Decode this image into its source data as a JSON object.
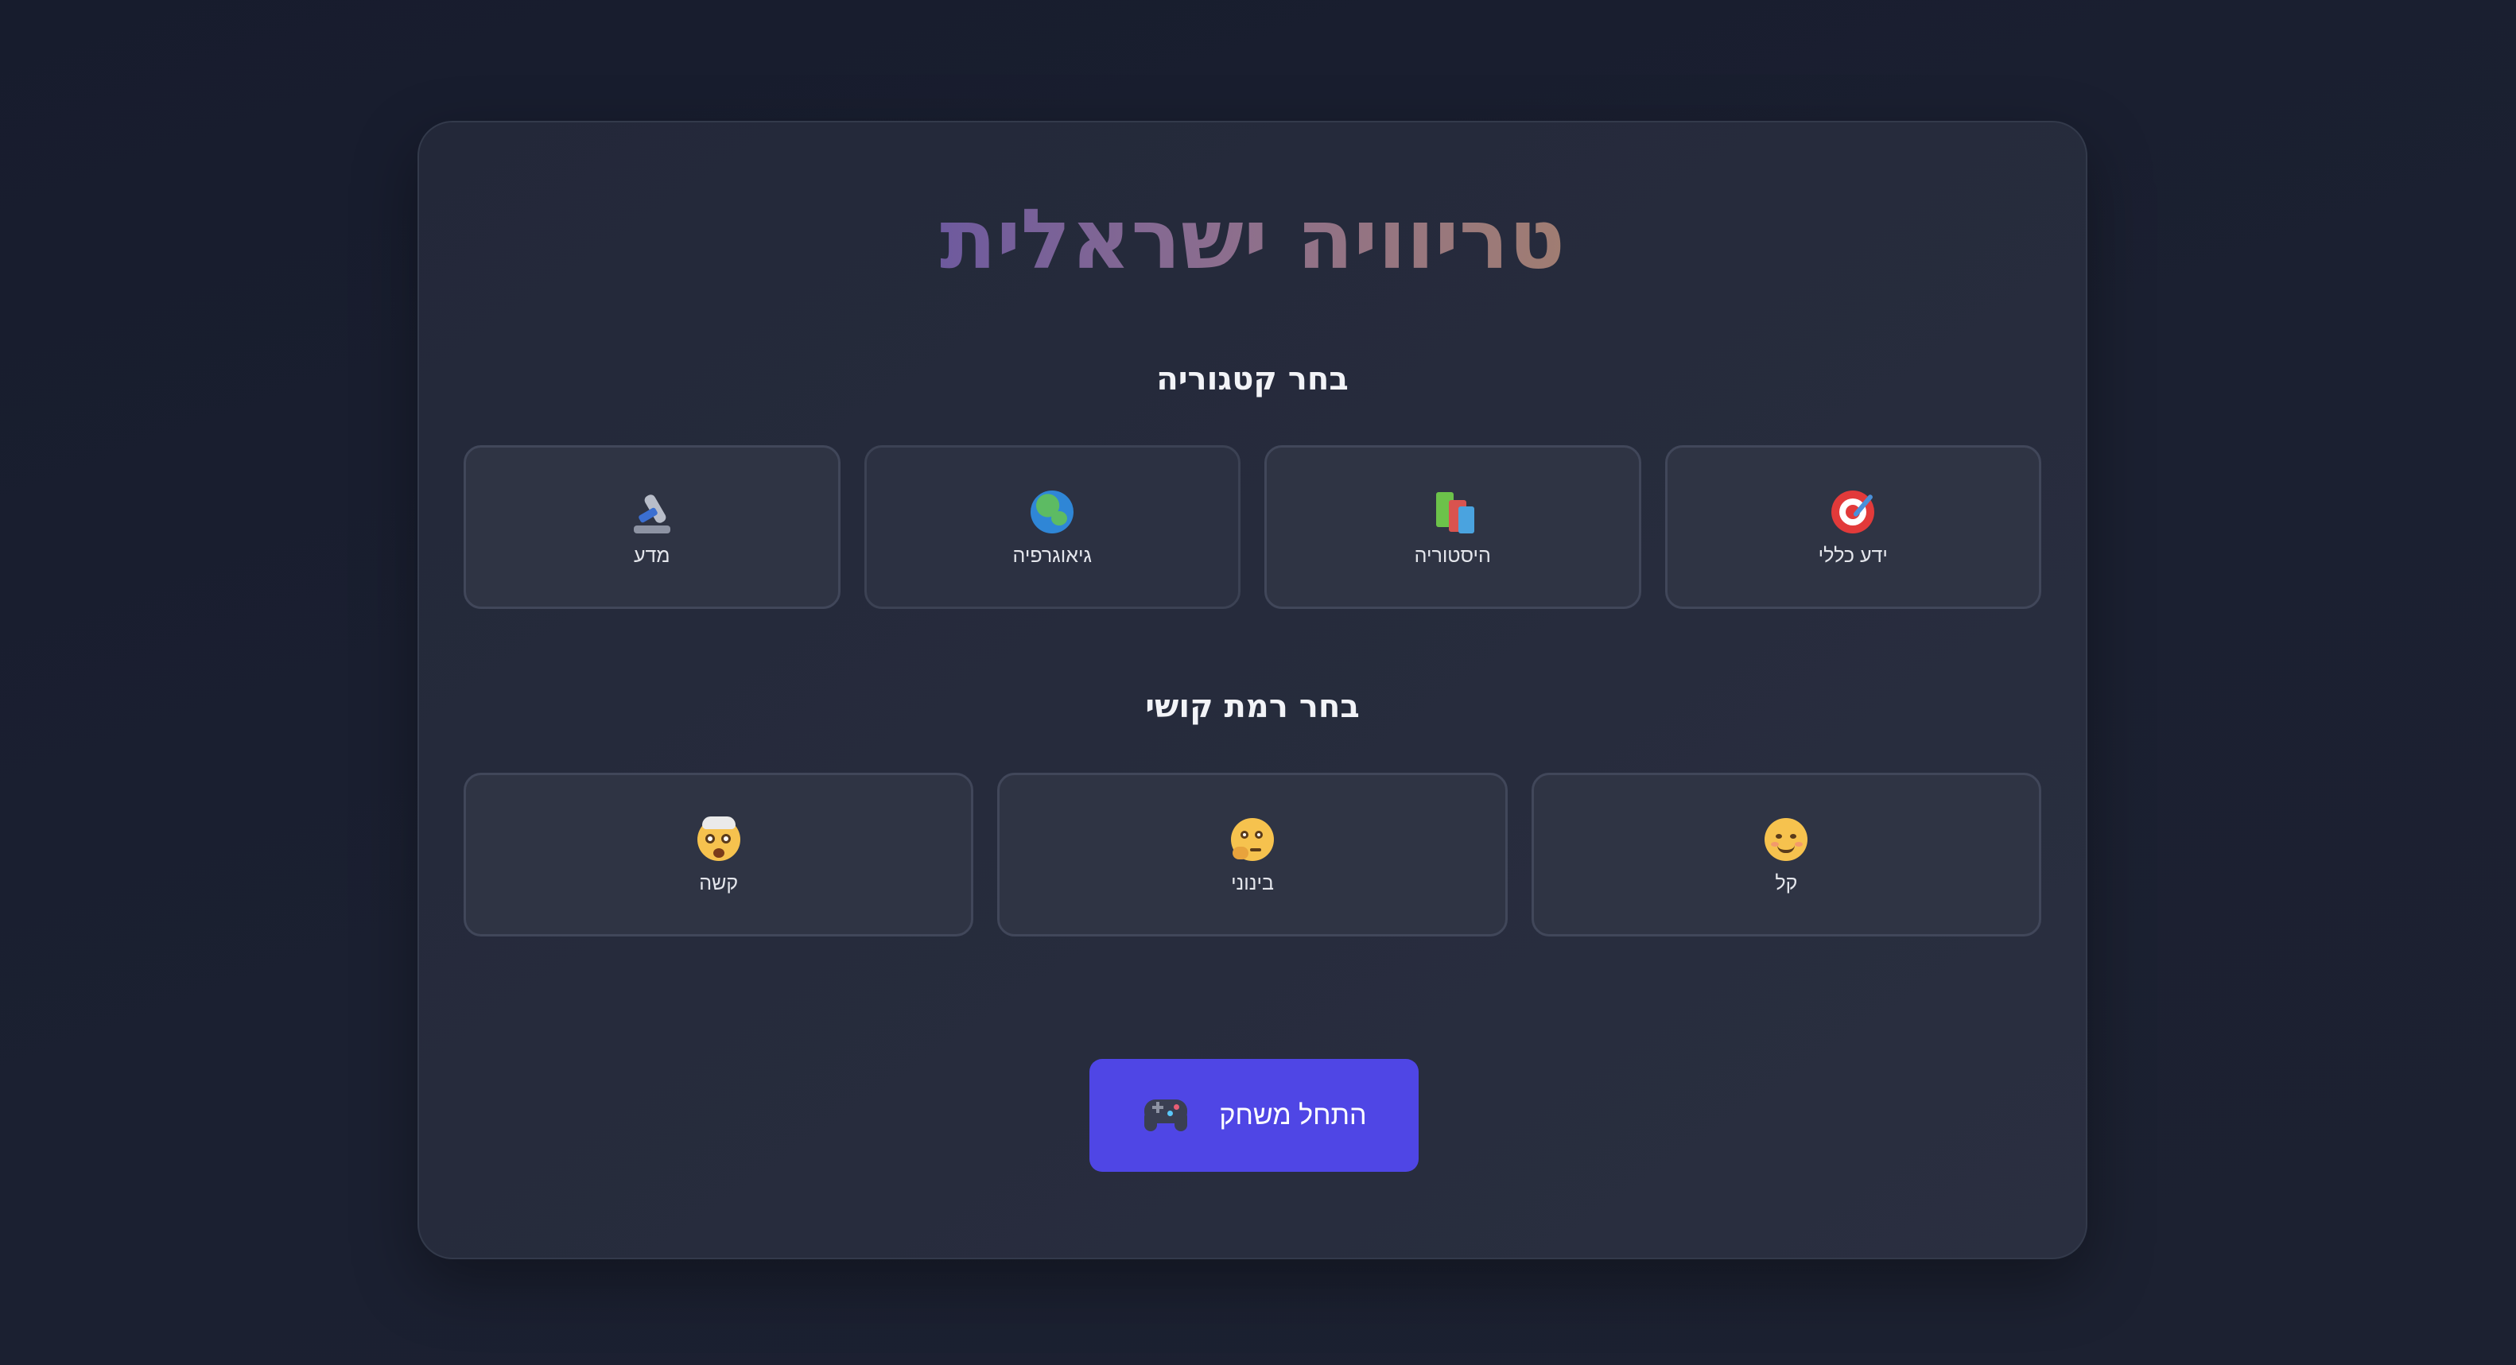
{
  "app": {
    "title": "טריוויה ישראלית"
  },
  "category_section": {
    "heading": "בחר קטגוריה",
    "options": [
      {
        "label": "ידע כללי",
        "icon": "target-icon"
      },
      {
        "label": "היסטוריה",
        "icon": "books-icon"
      },
      {
        "label": "גיאוגרפיה",
        "icon": "globe-icon",
        "selected": true
      },
      {
        "label": "מדע",
        "icon": "microscope-icon"
      }
    ]
  },
  "difficulty_section": {
    "heading": "בחר רמת קושי",
    "options": [
      {
        "label": "קל",
        "icon": "smiling-face-icon"
      },
      {
        "label": "בינוני",
        "icon": "thinking-face-icon"
      },
      {
        "label": "קשה",
        "icon": "exploding-head-icon"
      }
    ]
  },
  "start_button": {
    "label": "התחל משחק",
    "icon": "game-controller-icon"
  },
  "colors": {
    "background": "#171c2d",
    "card": "#262b3c",
    "option": "#2f3444",
    "option_border": "#41475a",
    "accent": "#4f46e5",
    "title_gradient_start": "#a07d72",
    "title_gradient_end": "#6e5a9e"
  }
}
